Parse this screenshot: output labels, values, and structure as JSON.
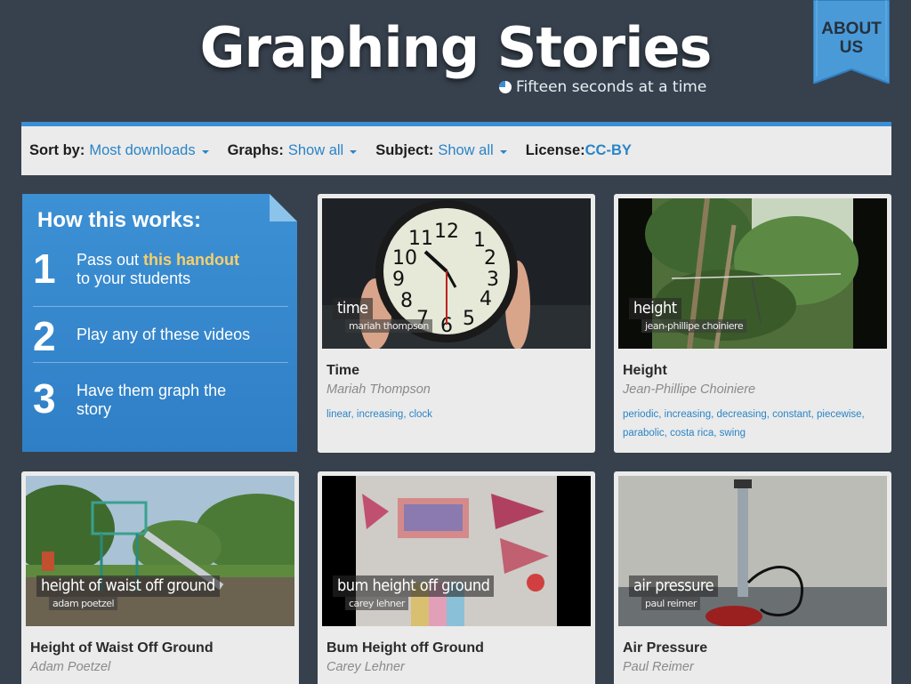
{
  "header": {
    "title": "Graphing Stories",
    "tagline": "Fifteen seconds at a time",
    "about_line1": "ABOUT",
    "about_line2": "US"
  },
  "filters": {
    "sort_label": "Sort by:",
    "sort_value": "Most downloads",
    "graphs_label": "Graphs:",
    "graphs_value": "Show all",
    "subject_label": "Subject:",
    "subject_value": "Show all",
    "license_label": "License:",
    "license_value": "CC-BY"
  },
  "howto": {
    "title": "How this works:",
    "step1_num": "1",
    "step1_before": "Pass out ",
    "step1_link": "this handout",
    "step1_after": "to your students",
    "step2_num": "2",
    "step2_text": "Play any of these videos",
    "step3_num": "3",
    "step3_text": "Have them graph the story"
  },
  "cards": [
    {
      "overlay_title": "time",
      "overlay_credit": "mariah thompson",
      "title": "Time",
      "author": "Mariah Thompson",
      "tags": [
        "linear",
        "increasing",
        "clock"
      ]
    },
    {
      "overlay_title": "height",
      "overlay_credit": "jean-phillipe choiniere",
      "title": "Height",
      "author": "Jean-Phillipe Choiniere",
      "tags": [
        "periodic",
        "increasing",
        "decreasing",
        "constant",
        "piecewise",
        "parabolic",
        "costa rica",
        "swing"
      ]
    },
    {
      "overlay_title": "height of waist off ground",
      "overlay_credit": "adam poetzel",
      "title": "Height of Waist Off Ground",
      "author": "Adam Poetzel",
      "tags": []
    },
    {
      "overlay_title": "bum height off ground",
      "overlay_credit": "carey lehner",
      "title": "Bum Height off Ground",
      "author": "Carey Lehner",
      "tags": []
    },
    {
      "overlay_title": "air pressure",
      "overlay_credit": "paul reimer",
      "title": "Air Pressure",
      "author": "Paul Reimer",
      "tags": []
    }
  ],
  "colors": {
    "background": "#37414d",
    "accent": "#3a8fd4",
    "link": "#2a84c6",
    "handout_link": "#f6cf6b"
  }
}
